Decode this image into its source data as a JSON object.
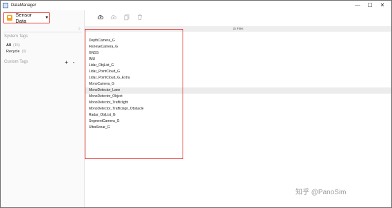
{
  "window": {
    "title": "DataManager",
    "minimize": "—",
    "maximize": "☐",
    "close": "✕"
  },
  "sidebar": {
    "dataset": "Sensor Data",
    "system_tags_title": "System Tags",
    "system_tags": [
      {
        "label": "All",
        "count": "(15)"
      },
      {
        "label": "Recycle",
        "count": "(0)"
      }
    ],
    "custom_tags_title": "Custom Tags",
    "add": "+",
    "remove": "-"
  },
  "main": {
    "files_count": "15 Files",
    "files": [
      "DepthCamera_G",
      "FisheyeCamera_G",
      "GNSS",
      "IMU",
      "Lidar_ObjList_G",
      "Lidar_PointCloud_G",
      "Lidar_PointCloud_G_Extra",
      "MonoCamera_G",
      "MonoDetector_Lane",
      "MonoDetector_Object",
      "MonoDetector_Trafficlight",
      "MonoDetector_Trafficsign_Obstacle",
      "Radar_ObjList_G",
      "SegmentCamera_G",
      "UltraSonar_G"
    ],
    "selected_index": 8
  },
  "watermark": "知乎 @PanoSim",
  "colors": {
    "highlight_border": "#e53935",
    "dataset_icon": "#f5a623",
    "selected_row": "#ececec"
  },
  "icons": {
    "toolbar": [
      "upload-cloud-icon",
      "download-cloud-icon",
      "copy-icon",
      "delete-icon"
    ]
  }
}
